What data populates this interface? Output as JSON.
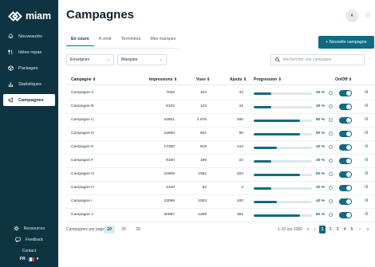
{
  "app": {
    "logo_text": "miam"
  },
  "sidebar": {
    "items": [
      {
        "label": "Nouveautés",
        "icon": "bell-icon"
      },
      {
        "label": "Idées repas",
        "icon": "utensils-icon"
      },
      {
        "label": "Packages",
        "icon": "package-icon"
      },
      {
        "label": "Statistiques",
        "icon": "chart-icon"
      },
      {
        "label": "Campagnes",
        "icon": "megaphone-icon",
        "active": true
      }
    ],
    "bottom_items": [
      {
        "label": "Ressources",
        "icon": "gear-icon"
      },
      {
        "label": "Feedback",
        "icon": "chat-icon"
      },
      {
        "label": "Contact"
      }
    ],
    "language": "FR"
  },
  "header": {
    "title": "Campagnes",
    "avatar_initials": "A",
    "help_icon": "info-icon"
  },
  "tabs": [
    {
      "label": "En cours",
      "active": true
    },
    {
      "label": "A venir"
    },
    {
      "label": "Terminées"
    },
    {
      "label": "Mes marques"
    }
  ],
  "actions": {
    "new_campaign_label": "+ Nouvelle campagne"
  },
  "filters": {
    "store_select": "Enseignes",
    "brand_select": "Marques",
    "search_placeholder": "Rechercher une campagne",
    "more_label": "···"
  },
  "table": {
    "columns": {
      "name": "Campagne ⇕",
      "impressions": "Impressions ⇕",
      "views": "Vues ⇕",
      "adds": "Ajouts ⇕",
      "progress": "Progression ⇕",
      "onoff": "On/Off ⇕"
    },
    "rows": [
      {
        "name": "Campagne A",
        "impressions": "7026",
        "views": "104",
        "adds": "44",
        "progress": 30,
        "progress_label": "30 %",
        "enabled": true
      },
      {
        "name": "Campagne B",
        "impressions": "8102",
        "views": "123",
        "adds": "41",
        "progress": 30,
        "progress_label": "30 %",
        "enabled": true
      },
      {
        "name": "Campagne C",
        "impressions": "34801",
        "views": "1.076",
        "adds": "300",
        "progress": 80,
        "progress_label": "80 %",
        "enabled": true
      },
      {
        "name": "Campagne D",
        "impressions": "16500",
        "views": "601",
        "adds": "90",
        "progress": 80,
        "progress_label": "80 %",
        "enabled": true
      },
      {
        "name": "Campagne E",
        "impressions": "17300",
        "views": "919",
        "adds": "144",
        "progress": 40,
        "progress_label": "40 %",
        "enabled": true
      },
      {
        "name": "Campagne F",
        "impressions": "9100",
        "views": "199",
        "adds": "22",
        "progress": 30,
        "progress_label": "30 %",
        "enabled": true
      },
      {
        "name": "Campagne G",
        "impressions": "24809",
        "views": "1062",
        "adds": "323",
        "progress": 80,
        "progress_label": "80 %",
        "enabled": true
      },
      {
        "name": "Campagne H",
        "impressions": "2100",
        "views": "62",
        "adds": "4",
        "progress": 30,
        "progress_label": "30 %",
        "enabled": true
      },
      {
        "name": "Campagne I",
        "impressions": "23099",
        "views": "1003",
        "adds": "100",
        "progress": 40,
        "progress_label": "40 %",
        "enabled": true
      },
      {
        "name": "Campagne J",
        "impressions": "30987",
        "views": "1269",
        "adds": "391",
        "progress": 80,
        "progress_label": "80 %",
        "enabled": true
      }
    ]
  },
  "pagination": {
    "per_page_label": "Campagnes par page",
    "per_page_options": [
      "10",
      "20",
      "30"
    ],
    "per_page_selected": "10",
    "range_label": "1-10 sur 2280",
    "first": "«",
    "prev": "‹",
    "pages": [
      "1",
      "2",
      "3",
      "4",
      "5"
    ],
    "current_page": "1",
    "next": "›",
    "last": "»"
  },
  "colors": {
    "sidebar": "#0f3441",
    "accent": "#0f6a82",
    "track": "#dde7eb"
  }
}
